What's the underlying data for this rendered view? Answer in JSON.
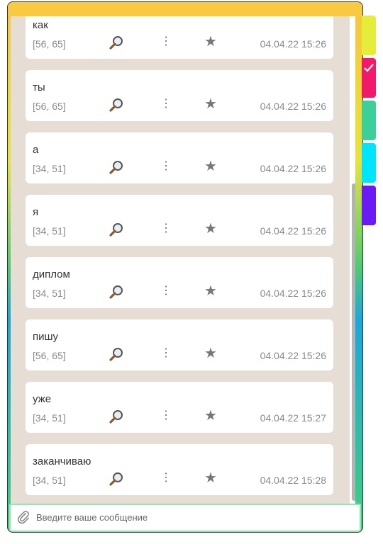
{
  "messages": [
    {
      "text": "как",
      "meta": "[56, 65]",
      "time": "04.04.22 15:26"
    },
    {
      "text": "ты",
      "meta": "[56, 65]",
      "time": "04.04.22 15:26"
    },
    {
      "text": "а",
      "meta": "[34, 51]",
      "time": "04.04.22 15:26"
    },
    {
      "text": "я",
      "meta": "[34, 51]",
      "time": "04.04.22 15:26"
    },
    {
      "text": "диплом",
      "meta": "[34, 51]",
      "time": "04.04.22 15:26"
    },
    {
      "text": "пишу",
      "meta": "[56, 65]",
      "time": "04.04.22 15:26"
    },
    {
      "text": "уже",
      "meta": "[34, 51]",
      "time": "04.04.22 15:27"
    },
    {
      "text": "заканчиваю",
      "meta": "[34, 51]",
      "time": "04.04.22 15:28"
    }
  ],
  "input": {
    "placeholder": "Введите ваше сообщение"
  },
  "tabs": [
    {
      "color": "#e6ec3a",
      "icon": ""
    },
    {
      "color": "#f2196a",
      "icon": "check-icon"
    },
    {
      "color": "#3ccf9a",
      "icon": ""
    },
    {
      "color": "#00e5ff",
      "icon": ""
    },
    {
      "color": "#6a1bf5",
      "icon": ""
    }
  ]
}
